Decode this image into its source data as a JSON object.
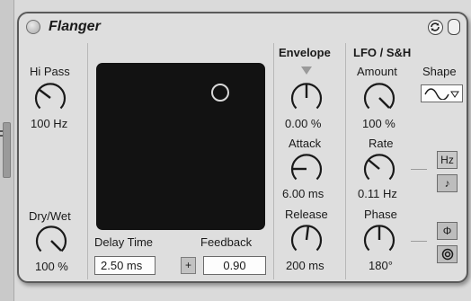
{
  "device": {
    "title": "Flanger"
  },
  "left_panel": {
    "hipass_label": "Hi Pass",
    "hipass_value": "100 Hz",
    "drywet_label": "Dry/Wet",
    "drywet_value": "100 %"
  },
  "center_panel": {
    "delay_time_label": "Delay Time",
    "delay_time_value": "2.50 ms",
    "feedback_label": "Feedback",
    "feedback_value": "0.90",
    "polarity_button": "+"
  },
  "envelope": {
    "heading": "Envelope",
    "amount_value": "0.00 %",
    "attack_label": "Attack",
    "attack_value": "6.00 ms",
    "release_label": "Release",
    "release_value": "200 ms"
  },
  "lfo": {
    "heading": "LFO / S&H",
    "amount_label": "Amount",
    "amount_value": "100 %",
    "shape_label": "Shape",
    "rate_label": "Rate",
    "rate_value": "0.11 Hz",
    "phase_label": "Phase",
    "phase_value": "180°",
    "hz_button": "Hz",
    "sync_note_icon": "♪",
    "phase_icon": "Φ",
    "spin_icon": "spin-icon"
  },
  "colors": {
    "pad": "#121212",
    "panel": "#dedede",
    "border": "#5a5a5a"
  }
}
